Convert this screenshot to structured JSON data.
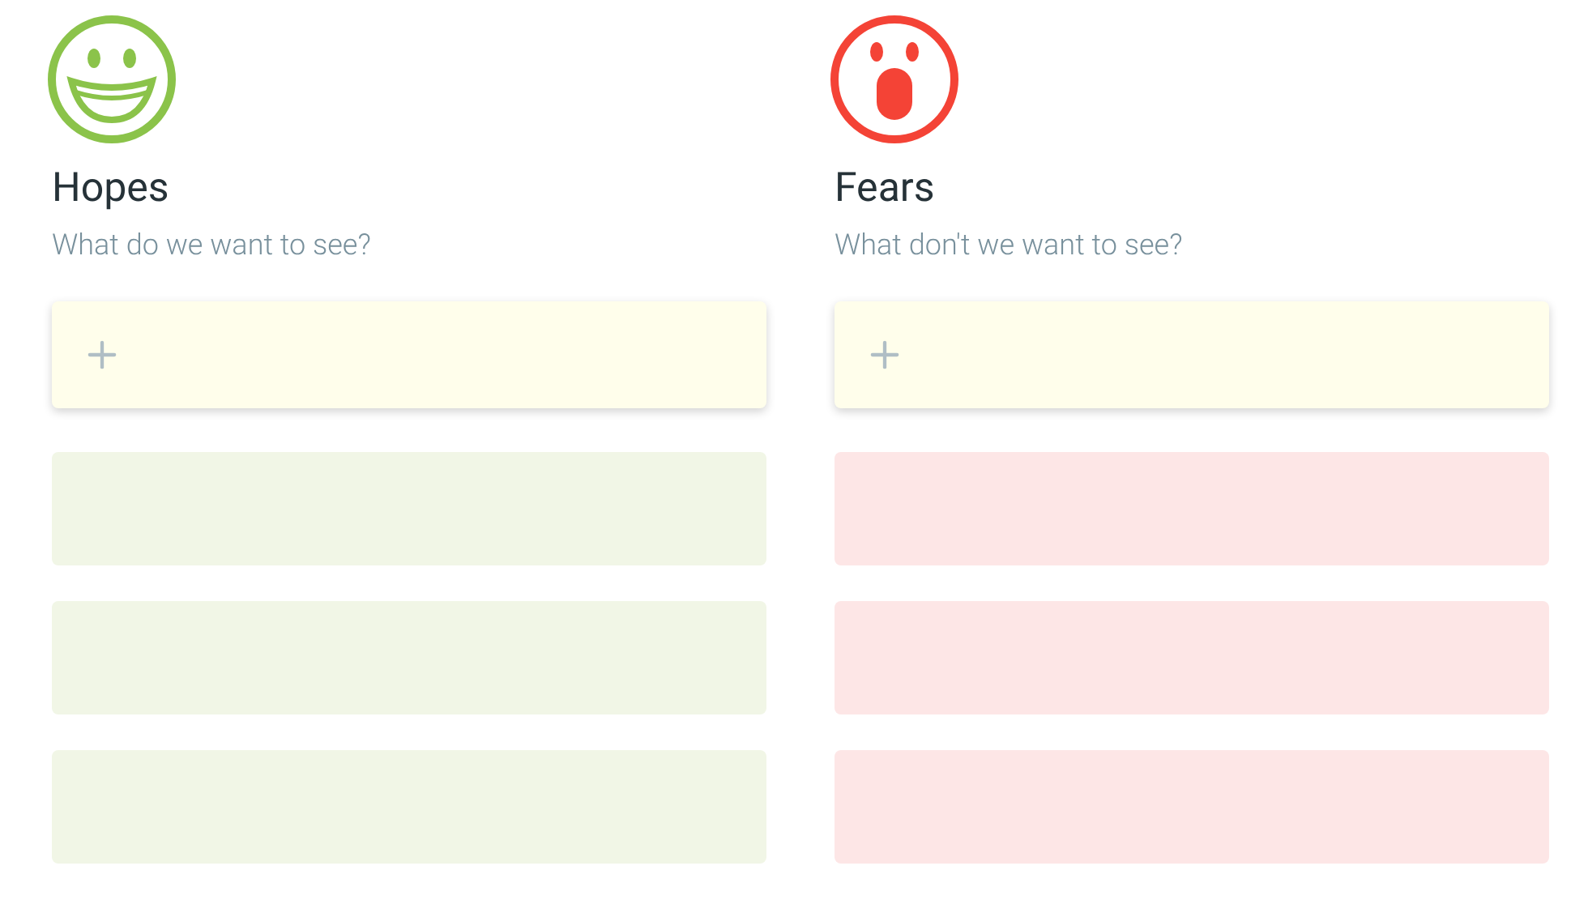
{
  "columns": [
    {
      "kind": "hopes",
      "title": "Hopes",
      "subtitle": "What do we want to see?",
      "color": "#8bc34a",
      "cards": [
        {
          "kind": "empty",
          "color": "#f1f6e6"
        },
        {
          "kind": "empty",
          "color": "#f1f6e6"
        },
        {
          "kind": "empty",
          "color": "#f1f6e6"
        }
      ]
    },
    {
      "kind": "fears",
      "title": "Fears",
      "subtitle": "What don't we want to see?",
      "color": "#f44336",
      "cards": [
        {
          "kind": "empty",
          "color": "#fde6e6"
        },
        {
          "kind": "empty",
          "color": "#fde6e6"
        },
        {
          "kind": "empty",
          "color": "#fde6e6"
        }
      ]
    }
  ]
}
